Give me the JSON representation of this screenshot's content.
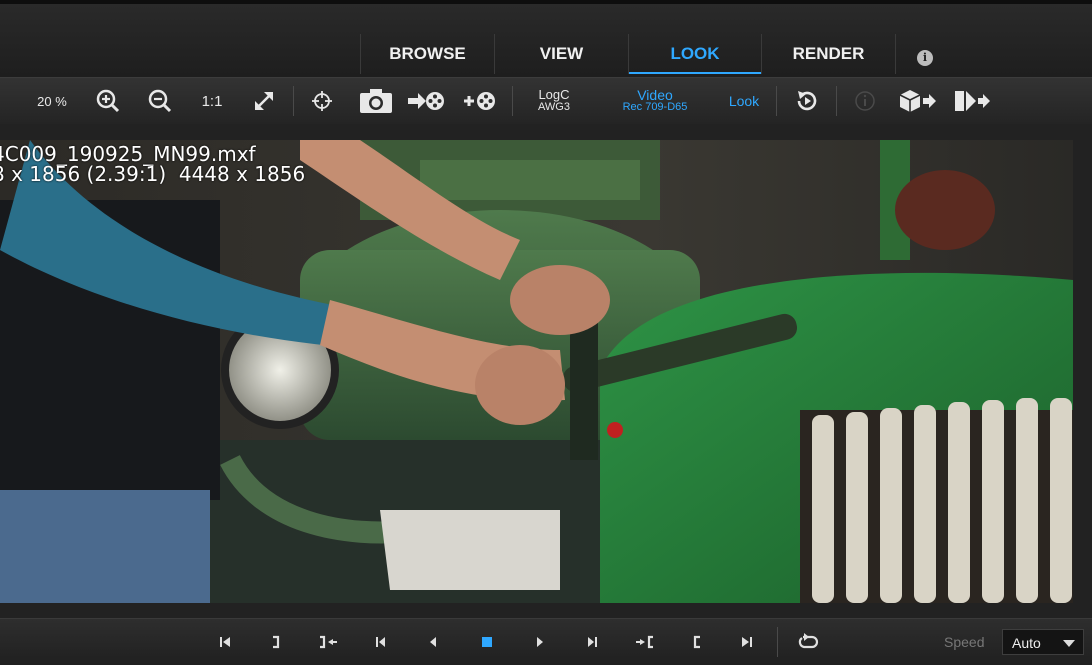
{
  "tabs": [
    {
      "label": "BROWSE",
      "active": false
    },
    {
      "label": "VIEW",
      "active": false
    },
    {
      "label": "LOOK",
      "active": true
    },
    {
      "label": "RENDER",
      "active": false
    }
  ],
  "info_icon": "info-icon",
  "toolbar": {
    "zoom_level": "20 %",
    "one_to_one": "1:1",
    "input_colorspace": {
      "name": "LogC",
      "sub": "AWG3"
    },
    "output_colorspace": {
      "name": "Video",
      "sub": "Rec 709-D65"
    },
    "look_label": "Look"
  },
  "overlay": {
    "filename": "4C009_190925_MN99.mxf",
    "resolution": "8 x 1856 (2.39:1)  4448 x 1856"
  },
  "transport": {
    "speed_label": "Speed",
    "speed_value": "Auto"
  },
  "colors": {
    "accent": "#2fa8ff",
    "background": "#1b1b1b"
  }
}
